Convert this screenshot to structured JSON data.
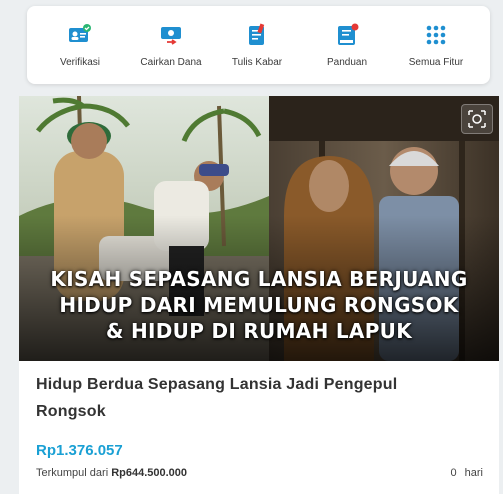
{
  "menu": {
    "items": [
      {
        "label": "Verifikasi",
        "icon": "verification-icon"
      },
      {
        "label": "Cairkan Dana",
        "icon": "withdraw-funds-icon"
      },
      {
        "label": "Tulis Kabar",
        "icon": "write-news-icon"
      },
      {
        "label": "Panduan",
        "icon": "guide-icon"
      },
      {
        "label": "Semua Fitur",
        "icon": "all-features-grid-icon"
      }
    ]
  },
  "campaign": {
    "image_text": [
      "KISAH SEPASANG LANSIA BERJUANG",
      "HIDUP DARI MEMULUNG RONGSOK",
      "& HIDUP DI RUMAH LAPUK"
    ],
    "title": "Hidup Berdua Sepasang Lansia Jadi Pengepul Rongsok",
    "amount": "Rp1.376.057",
    "collected_prefix": "Terkumpul dari",
    "target": "Rp644.500.000",
    "days_value": "0",
    "days_label": "hari"
  },
  "colors": {
    "accent": "#1aa0d4",
    "icon_blue": "#1f8fd0",
    "icon_red": "#e53935",
    "icon_green": "#2bb673"
  }
}
